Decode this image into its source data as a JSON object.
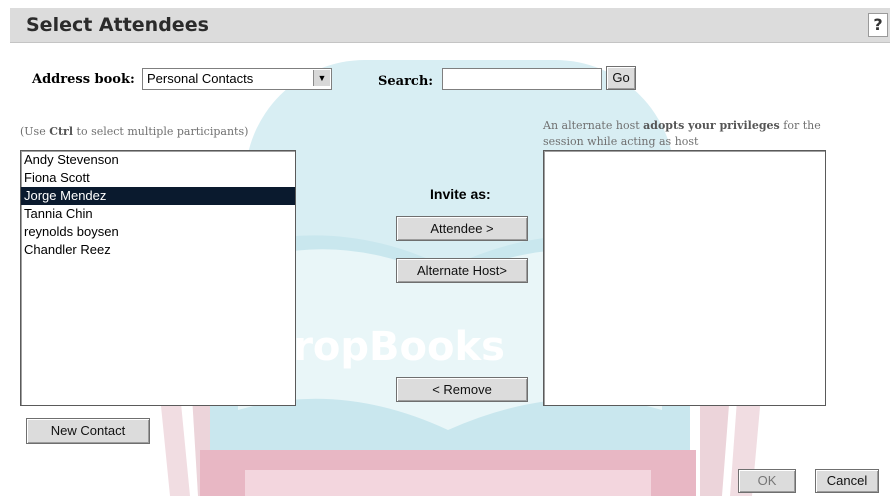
{
  "window": {
    "title": "Select Attendees",
    "help_label": "?"
  },
  "address_book": {
    "label": "Address book:",
    "selected": "Personal Contacts"
  },
  "search": {
    "label": "Search:",
    "value": "",
    "go_label": "Go"
  },
  "contacts": {
    "hint_prefix": "(Use ",
    "hint_key": "Ctrl",
    "hint_suffix": " to select multiple participants)",
    "items": [
      {
        "name": "Andy Stevenson",
        "selected": false
      },
      {
        "name": "Fiona Scott",
        "selected": false
      },
      {
        "name": "Jorge Mendez",
        "selected": true
      },
      {
        "name": "Tannia Chin",
        "selected": false
      },
      {
        "name": "reynolds boysen",
        "selected": false
      },
      {
        "name": "Chandler Reez",
        "selected": false
      }
    ]
  },
  "alternate_note": {
    "prefix": "An alternate host ",
    "bold": "adopts your privileges",
    "suffix": " for the session while acting as host"
  },
  "invite": {
    "label": "Invite as:",
    "attendee_btn": "Attendee >",
    "alt_host_btn": "Alternate Host>",
    "remove_btn": "< Remove"
  },
  "footer": {
    "new_contact": "New Contact",
    "ok": "OK",
    "cancel": "Cancel"
  },
  "watermark": {
    "text": "DropBooks"
  },
  "colors": {
    "selection": "#0a1a2e",
    "titlebar": "#dcdcdc",
    "button": "#dcdcdc"
  }
}
